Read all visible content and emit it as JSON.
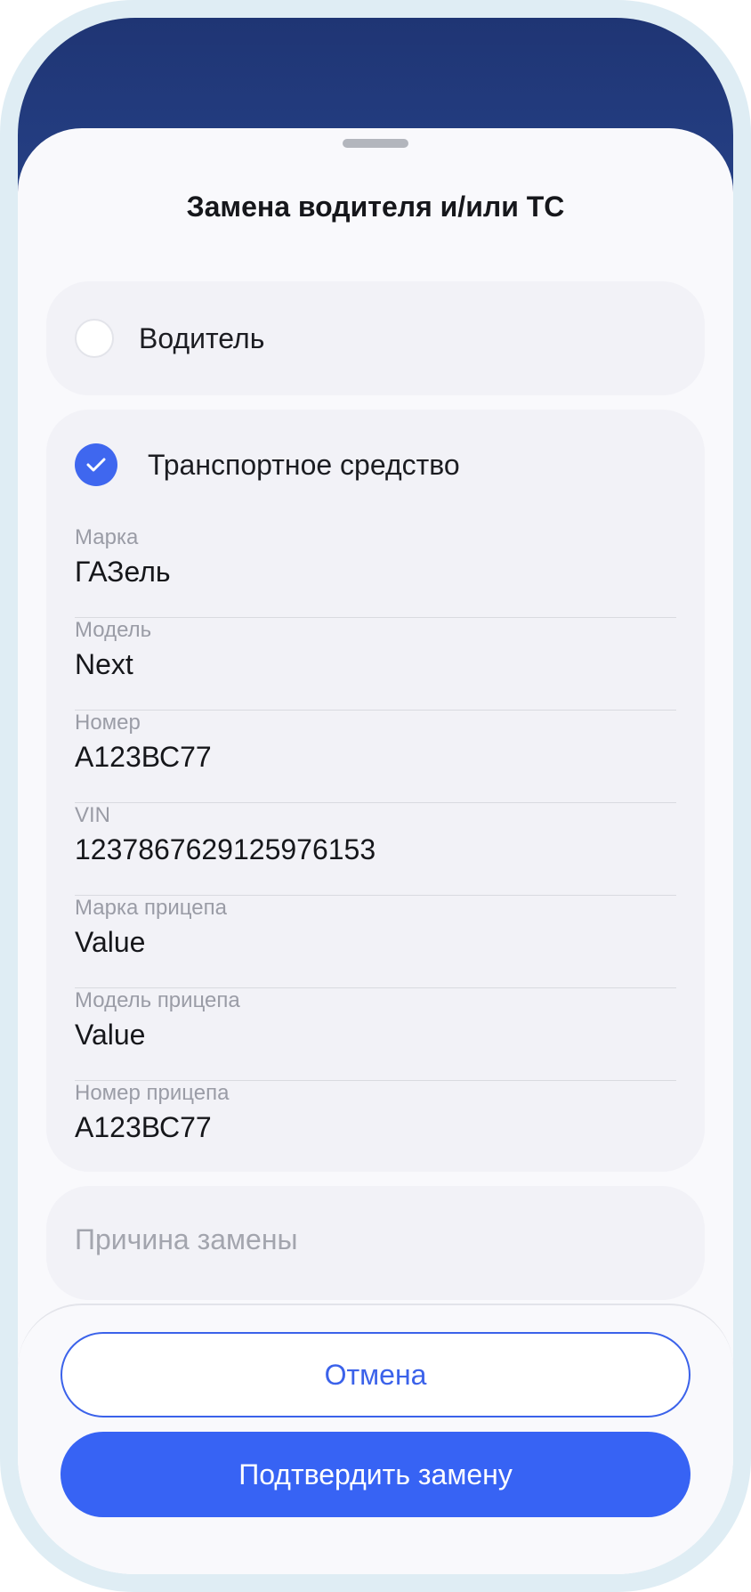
{
  "sheet": {
    "title": "Замена водителя и/или ТС"
  },
  "options": {
    "driver": {
      "label": "Водитель",
      "checked": false
    },
    "vehicle": {
      "label": "Транспортное средство",
      "checked": true
    }
  },
  "vehicle_fields": [
    {
      "label": "Марка",
      "value": "ГАЗель"
    },
    {
      "label": "Модель",
      "value": "Next"
    },
    {
      "label": "Номер",
      "value": "А123ВС77"
    },
    {
      "label": "VIN",
      "value": "1237867629125976153"
    },
    {
      "label": "Марка прицепа",
      "value": "Value"
    },
    {
      "label": "Модель прицепа",
      "value": "Value"
    },
    {
      "label": "Номер прицепа",
      "value": "А123ВС77"
    }
  ],
  "reason": {
    "placeholder": "Причина замены"
  },
  "buttons": {
    "cancel": "Отмена",
    "confirm": "Подтвердить замену"
  },
  "colors": {
    "header": "#1f3574",
    "accent": "#3763f4",
    "card": "#f2f2f7"
  },
  "icons": {
    "check": "check-icon"
  }
}
